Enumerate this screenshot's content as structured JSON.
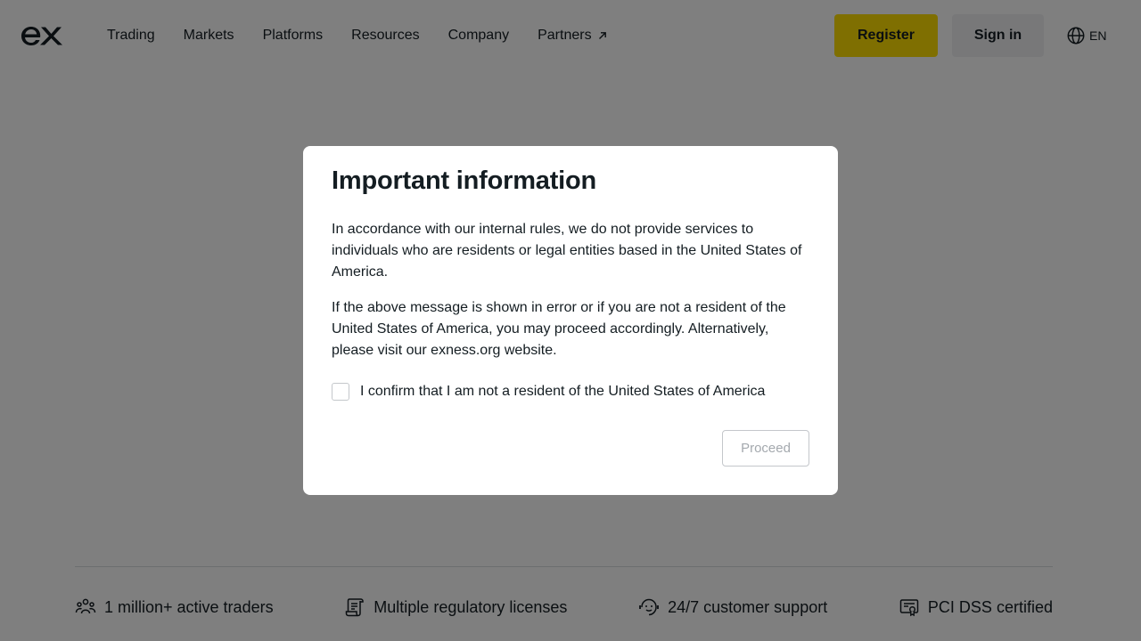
{
  "header": {
    "logo_text": "ex",
    "nav": [
      {
        "label": "Trading"
      },
      {
        "label": "Markets"
      },
      {
        "label": "Platforms"
      },
      {
        "label": "Resources"
      },
      {
        "label": "Company"
      },
      {
        "label": "Partners",
        "external": true
      }
    ],
    "register_label": "Register",
    "signin_label": "Sign in",
    "language": "EN"
  },
  "features": [
    {
      "icon": "users-icon",
      "label": "1 million+ active traders"
    },
    {
      "icon": "license-icon",
      "label": "Multiple regulatory licenses"
    },
    {
      "icon": "support-icon",
      "label": "24/7 customer support"
    },
    {
      "icon": "certificate-icon",
      "label": "PCI DSS certified"
    }
  ],
  "modal": {
    "title": "Important information",
    "paragraph1": "In accordance with our internal rules, we do not provide services to individuals who are residents or legal entities based in the United States of America.",
    "paragraph2": "If the above message is shown in error or if you are not a resident of the United States of America, you may proceed accordingly. Alternatively, please visit our exness.org website.",
    "confirm_label": "I confirm that I am not a resident of the United States of America",
    "confirm_checked": false,
    "proceed_label": "Proceed",
    "proceed_enabled": false
  },
  "colors": {
    "brand_yellow": "#ffde02",
    "overlay": "rgba(0,0,0,0.5)",
    "text": "#141d22"
  }
}
